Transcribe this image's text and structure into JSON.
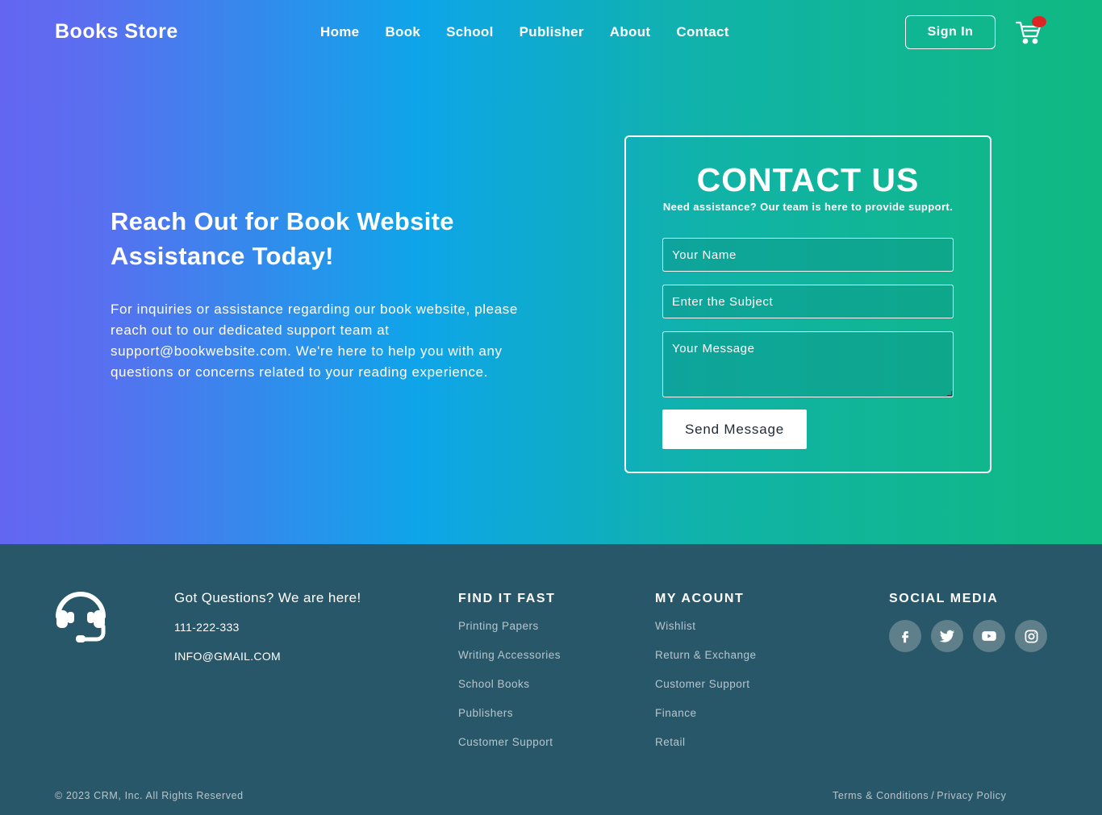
{
  "nav": {
    "brand": "Books Store",
    "links": [
      "Home",
      "Book",
      "School",
      "Publisher",
      "About",
      "Contact"
    ],
    "signin_label": "Sign In",
    "cart_icon": "shopping-cart-icon",
    "cart_badge_color": "#dc2626"
  },
  "hero": {
    "title": "Reach Out for Book Website Assistance Today!",
    "text": "For inquiries or assistance regarding our book website, please reach out to our dedicated support team at support@bookwebsite.com. We're here to help you with any questions or concerns related to your reading experience.",
    "gradient": [
      "#6366f1",
      "#0ea5e9",
      "#10b981"
    ]
  },
  "contact": {
    "title": "CONTACT US",
    "subtitle": "Need assistance? Our team is here to provide support.",
    "name_placeholder": "Your Name",
    "subject_placeholder": "Enter the Subject",
    "message_placeholder": "Your Message",
    "send_label": "Send Message"
  },
  "footer": {
    "background": "#285769",
    "support_icon": "headset-icon",
    "questions": "Got Questions? We are here!",
    "phone": "111-222-333",
    "email": "INFO@GMAIL.COM",
    "find_title": "FIND IT FAST",
    "find_links": [
      "Printing Papers",
      "Writing Accessories",
      "School Books",
      "Publishers",
      "Customer Support"
    ],
    "account_title": "MY ACOUNT",
    "account_links": [
      "Wishlist",
      "Return & Exchange",
      "Customer Support",
      "Finance",
      "Retail"
    ],
    "social_title": "SOCIAL MEDIA",
    "social_icons": [
      "facebook-icon",
      "twitter-icon",
      "youtube-icon",
      "instagram-icon"
    ],
    "copyright": "© 2023 CRM, Inc. All Rights Reserved",
    "terms": "Terms & Conditions",
    "separator": "/",
    "privacy": "Privacy Policy"
  }
}
